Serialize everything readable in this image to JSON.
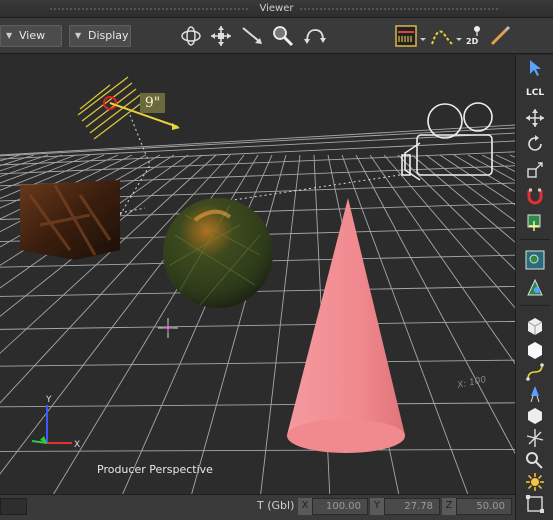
{
  "window": {
    "title": "Viewer"
  },
  "toolbar": {
    "view_label": "View",
    "display_label": "Display",
    "icons": [
      "orbit-icon",
      "pan-icon",
      "move-icon",
      "zoom-icon",
      "undo-view-icon",
      "display-mode-icon",
      "trajectory-icon",
      "2d-view-icon",
      "brush-icon"
    ],
    "view2d_text": "2D"
  },
  "viewport": {
    "camera_label": "Producer Perspective",
    "dimension_text": "9\"",
    "axis_labels": {
      "x": "X",
      "y": "Y"
    },
    "grid_label": "X: 100"
  },
  "sidebar": {
    "local_label": "LCL",
    "icons": [
      "select-cursor-icon",
      "local-space-icon",
      "translate-icon",
      "rotate-icon",
      "scale-icon",
      "magnet-icon",
      "snap-plane-icon",
      "move-pivot-icon",
      "zoom-object-icon",
      "zoom-transform-icon",
      "cube-solid-icon",
      "cube-flat-icon",
      "curve-icon",
      "light-icon",
      "shape-icon",
      "skeleton-icon",
      "key-icon",
      "sun-icon",
      "frame-icon"
    ]
  },
  "statusbar": {
    "transform_label": "T (Gbl)",
    "x_label": "X",
    "x_value": "100.00",
    "y_label": "Y",
    "y_value": "27.78",
    "z_label": "Z",
    "z_value": "50.00"
  },
  "colors": {
    "cone": "#f08a8f",
    "accent_selection": "#4a7bd6"
  }
}
